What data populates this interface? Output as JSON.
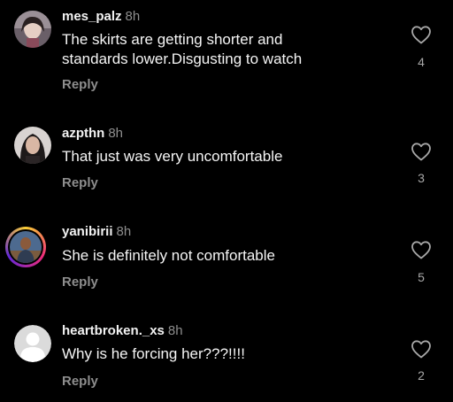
{
  "comments": [
    {
      "username": "mes_palz",
      "time": "8h",
      "text_line1": "The skirts are getting shorter and",
      "text_line2": "standards lower.Disgusting to watch",
      "reply_label": "Reply",
      "likes": "4"
    },
    {
      "username": "azpthn",
      "time": "8h",
      "text_line1": "That just was very uncomfortable",
      "reply_label": "Reply",
      "likes": "3"
    },
    {
      "username": "yanibirii",
      "time": "8h",
      "text_line1": "She is definitely not comfortable",
      "reply_label": "Reply",
      "likes": "5"
    },
    {
      "username": "heartbroken._xs",
      "time": "8h",
      "text_line1": "Why is he forcing her???!!!!",
      "reply_label": "Reply",
      "likes": "2"
    }
  ],
  "icons": {
    "like": "heart-outline-icon",
    "default_avatar": "default-avatar-icon"
  },
  "colors": {
    "background": "#000000",
    "primary_text": "#f5f5f5",
    "secondary_text": "#8e8e8e"
  }
}
